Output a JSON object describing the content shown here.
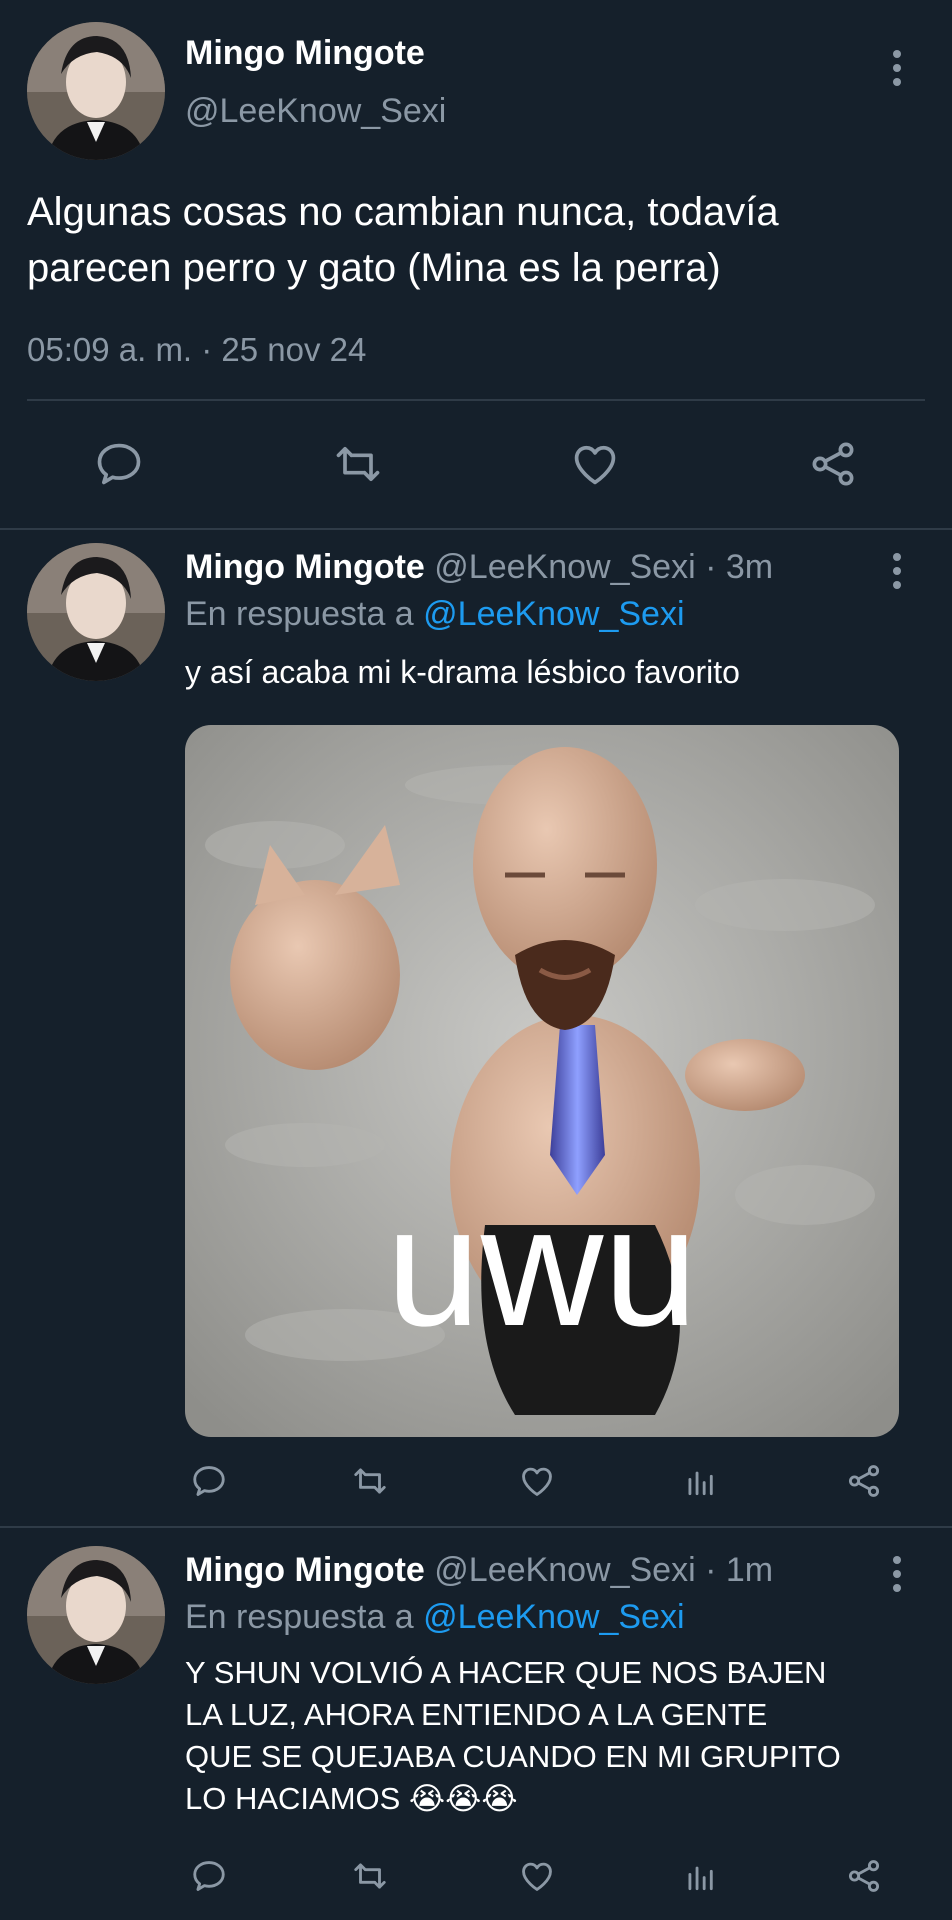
{
  "main_tweet": {
    "display_name": "Mingo Mingote",
    "handle": "@LeeKnow_Sexi",
    "text_line1": "Algunas cosas no cambian nunca, todavía",
    "text_line2": "parecen perro y gato (Mina es la perra)",
    "timestamp": "05:09 a. m. · 25 nov 24"
  },
  "replies": [
    {
      "display_name": "Mingo Mingote",
      "handle_time": "@LeeKnow_Sexi · 3m",
      "reply_prefix": "En respuesta a",
      "reply_to": "@LeeKnow_Sexi",
      "text": "y así acaba mi k-drama lésbico favorito",
      "media_caption": "uwu"
    },
    {
      "display_name": "Mingo Mingote",
      "handle_time": "@LeeKnow_Sexi · 1m",
      "reply_prefix": "En respuesta a",
      "reply_to": "@LeeKnow_Sexi",
      "text_lines": [
        "Y SHUN VOLVIÓ A HACER QUE NOS BAJEN",
        "LA LUZ, AHORA ENTIENDO A LA GENTE",
        "QUE SE QUEJABA CUANDO EN MI GRUPITO",
        "LO HACIAMOS 😭😭😭"
      ]
    }
  ],
  "icons": [
    "more-vertical-icon",
    "reply-icon",
    "retweet-icon",
    "like-icon",
    "analytics-icon",
    "share-icon"
  ],
  "colors": {
    "background": "#15202b",
    "muted": "#8b98a5",
    "link": "#1d9bf0",
    "divider": "#2f3b47"
  }
}
